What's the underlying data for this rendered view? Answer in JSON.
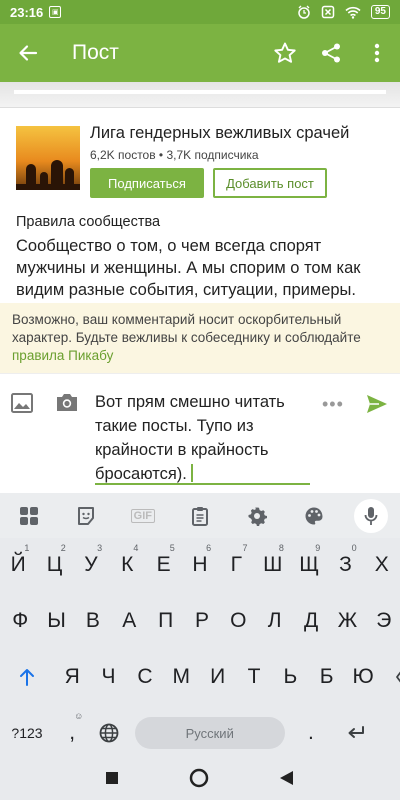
{
  "status_bar": {
    "time": "23:16",
    "battery": "95"
  },
  "app_bar": {
    "title": "Пост"
  },
  "community": {
    "name": "Лига гендерных вежливых срачей",
    "stats": "6,2K постов • 3,7K подписчика",
    "subscribe_label": "Подписаться",
    "add_post_label": "Добавить пост",
    "rules_title": "Правила сообщества",
    "rules_text": "Сообщество о том, о чем всегда спорят мужчины и женщины. А мы спорим о том как видим разные события, ситуации, примеры."
  },
  "warning": {
    "text": "Возможно, ваш комментарий носит оскорбительный характер. Будьте вежливы к собеседнику и соблюдайте ",
    "link": "правила Пикабу"
  },
  "composer": {
    "text": "Вот прям смешно читать такие посты. Тупо из крайности в крайность бросаются).",
    "more": "•••"
  },
  "keyboard_toolbar": {
    "gif_label": "GIF"
  },
  "keyboard": {
    "row1": [
      {
        "k": "Й",
        "h": "1"
      },
      {
        "k": "Ц",
        "h": "2"
      },
      {
        "k": "У",
        "h": "3"
      },
      {
        "k": "К",
        "h": "4"
      },
      {
        "k": "Е",
        "h": "5"
      },
      {
        "k": "Н",
        "h": "6"
      },
      {
        "k": "Г",
        "h": "7"
      },
      {
        "k": "Ш",
        "h": "8"
      },
      {
        "k": "Щ",
        "h": "9"
      },
      {
        "k": "З",
        "h": "0"
      },
      {
        "k": "Х",
        "h": ""
      }
    ],
    "row2": [
      "Ф",
      "Ы",
      "В",
      "А",
      "П",
      "Р",
      "О",
      "Л",
      "Д",
      "Ж",
      "Э"
    ],
    "row3": [
      "Я",
      "Ч",
      "С",
      "М",
      "И",
      "Т",
      "Ь",
      "Б",
      "Ю"
    ],
    "symbols_label": "?123",
    "comma_label": ",",
    "period_label": ".",
    "space_label": "Русский"
  },
  "colors": {
    "accent": "#7cb342",
    "status_bar": "#6fa83a",
    "warning_bg": "#fbf6e1",
    "link": "#6a9f2e"
  }
}
